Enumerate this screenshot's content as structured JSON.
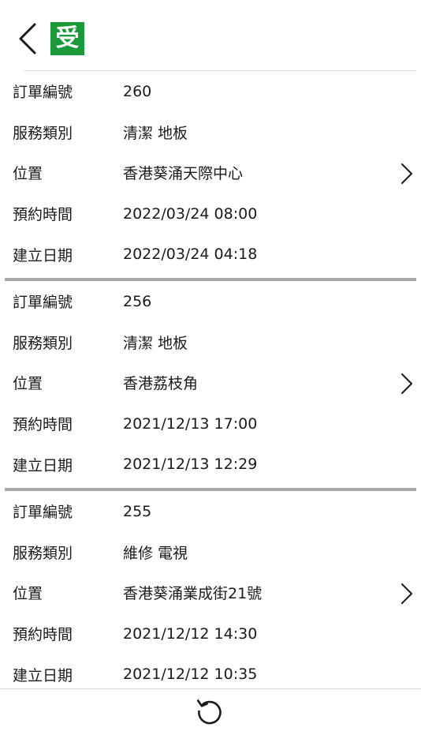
{
  "header": {
    "back_icon": "chevron-left-icon",
    "logo_text": "受",
    "logo_color": "#1c9a3a"
  },
  "orders": [
    {
      "rows": [
        {
          "label": "訂單編號",
          "value": "260"
        },
        {
          "label": "服務類別",
          "value": "清潔 地板"
        },
        {
          "label": "位置",
          "value": "香港葵涌天際中心"
        },
        {
          "label": "預約時間",
          "value": "2022/03/24 08:00"
        },
        {
          "label": "建立日期",
          "value": "2022/03/24 04:18"
        }
      ]
    },
    {
      "rows": [
        {
          "label": "訂單編號",
          "value": "256"
        },
        {
          "label": "服務類別",
          "value": "清潔 地板"
        },
        {
          "label": "位置",
          "value": "香港荔枝角"
        },
        {
          "label": "預約時間",
          "value": "2021/12/13 17:00"
        },
        {
          "label": "建立日期",
          "value": "2021/12/13 12:29"
        }
      ]
    },
    {
      "rows": [
        {
          "label": "訂單編號",
          "value": "255"
        },
        {
          "label": "服務類別",
          "value": "維修 電視"
        },
        {
          "label": "位置",
          "value": "香港葵涌業成街21號"
        },
        {
          "label": "預約時間",
          "value": "2021/12/12 14:30"
        },
        {
          "label": "建立日期",
          "value": "2021/12/12 10:35"
        }
      ]
    }
  ],
  "footer": {
    "refresh_icon": "refresh-icon"
  }
}
